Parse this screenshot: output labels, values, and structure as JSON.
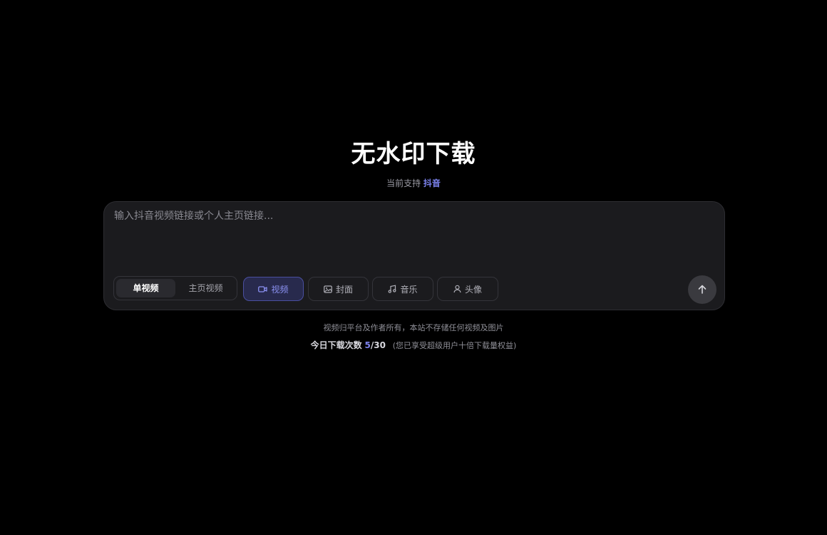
{
  "header": {
    "title": "无水印下载",
    "support_prefix": "当前支持",
    "support_platform": "抖音"
  },
  "input": {
    "placeholder": "输入抖音视频链接或个人主页链接...",
    "value": ""
  },
  "mode_toggle": {
    "options": [
      "单视频",
      "主页视频"
    ],
    "selected": "单视频"
  },
  "content_types": [
    {
      "label": "视频",
      "icon": "video-icon",
      "selected": true
    },
    {
      "label": "封面",
      "icon": "image-icon",
      "selected": false
    },
    {
      "label": "音乐",
      "icon": "music-note-icon",
      "selected": false
    },
    {
      "label": "头像",
      "icon": "user-icon",
      "selected": false
    }
  ],
  "submit_icon": "arrow-up-icon",
  "footer": {
    "notice": "视频归平台及作者所有，本站不存储任何视频及图片",
    "quota_label": "今日下载次数",
    "quota_used": "5",
    "quota_sep": "/",
    "quota_total": "30",
    "quota_note": "(您已享受超级用户十倍下载量权益)"
  },
  "colors": {
    "background": "#000000",
    "panel": "#1b1b1e",
    "accent": "#7c83ee",
    "selected_chip_bg": "#282a4d"
  }
}
